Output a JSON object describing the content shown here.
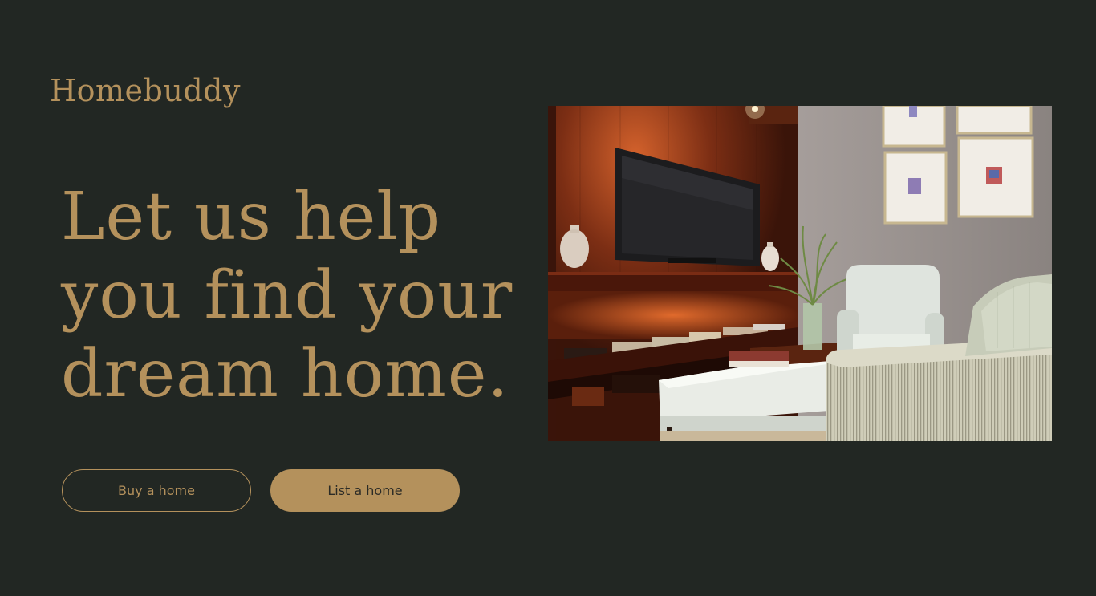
{
  "brand": {
    "name": "Homebuddy"
  },
  "hero": {
    "headline_lines": [
      "Let us help",
      "you find your",
      "dream home."
    ]
  },
  "actions": {
    "buy_label": "Buy a home",
    "list_label": "List a home"
  },
  "colors": {
    "background": "#222723",
    "accent": "#b4915c",
    "button_dark_text": "#2b2b26"
  },
  "image": {
    "description_icon": "living-room-photo"
  }
}
